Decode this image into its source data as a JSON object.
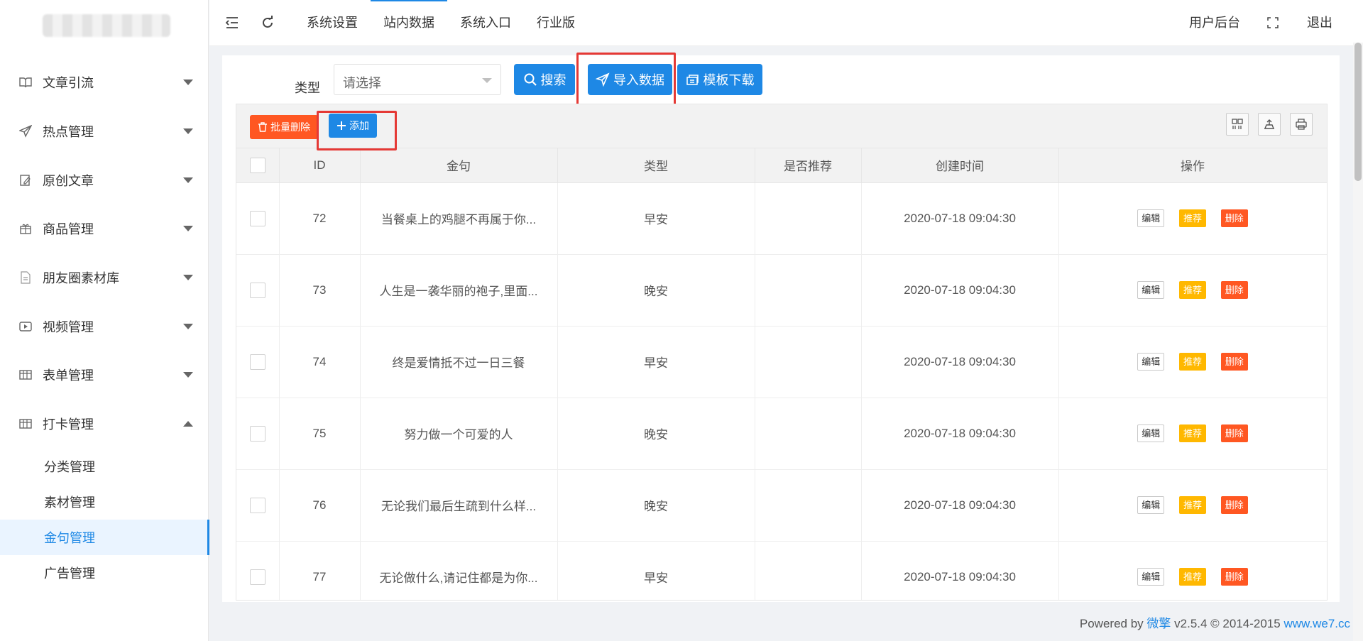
{
  "sidebar": {
    "menu": [
      {
        "label": "文章引流",
        "icon": "book-icon"
      },
      {
        "label": "热点管理",
        "icon": "send-icon"
      },
      {
        "label": "原创文章",
        "icon": "edit-icon"
      },
      {
        "label": "商品管理",
        "icon": "gift-icon"
      },
      {
        "label": "朋友圈素材库",
        "icon": "file-icon"
      },
      {
        "label": "视频管理",
        "icon": "video-icon"
      },
      {
        "label": "表单管理",
        "icon": "table-icon"
      },
      {
        "label": "打卡管理",
        "icon": "table-icon"
      }
    ],
    "submenu": [
      "分类管理",
      "素材管理",
      "金句管理",
      "广告管理"
    ]
  },
  "topbar": {
    "links": [
      "系统设置",
      "站内数据",
      "系统入口",
      "行业版"
    ],
    "user": "用户后台",
    "logout": "退出"
  },
  "filter": {
    "type_label": "类型",
    "select_placeholder": "请选择",
    "search": "搜索",
    "import": "导入数据",
    "template": "模板下载"
  },
  "toolbar": {
    "batch_delete": "批量删除",
    "add": "添加"
  },
  "table": {
    "headers": [
      "ID",
      "金句",
      "类型",
      "是否推荐",
      "创建时间",
      "操作"
    ],
    "actions": {
      "edit": "编辑",
      "recommend": "推荐",
      "delete": "删除"
    },
    "rows": [
      {
        "id": "72",
        "text": "当餐桌上的鸡腿不再属于你...",
        "type": "早安",
        "recommend": "",
        "time": "2020-07-18 09:04:30"
      },
      {
        "id": "73",
        "text": "人生是一袭华丽的袍子,里面...",
        "type": "晚安",
        "recommend": "",
        "time": "2020-07-18 09:04:30"
      },
      {
        "id": "74",
        "text": "终是爱情抵不过一日三餐",
        "type": "早安",
        "recommend": "",
        "time": "2020-07-18 09:04:30"
      },
      {
        "id": "75",
        "text": "努力做一个可爱的人",
        "type": "晚安",
        "recommend": "",
        "time": "2020-07-18 09:04:30"
      },
      {
        "id": "76",
        "text": "无论我们最后生疏到什么样...",
        "type": "晚安",
        "recommend": "",
        "time": "2020-07-18 09:04:30"
      },
      {
        "id": "77",
        "text": "无论做什么,请记住都是为你...",
        "type": "早安",
        "recommend": "",
        "time": "2020-07-18 09:04:30"
      }
    ]
  },
  "footer": {
    "powered": "Powered by",
    "brand": "微擎",
    "version": "v2.5.4 © 2014-2015",
    "site": "www.we7.cc"
  },
  "colors": {
    "primary": "#1e88e5",
    "danger": "#ff5722",
    "warning": "#ffb800",
    "highlight": "#e53935"
  }
}
